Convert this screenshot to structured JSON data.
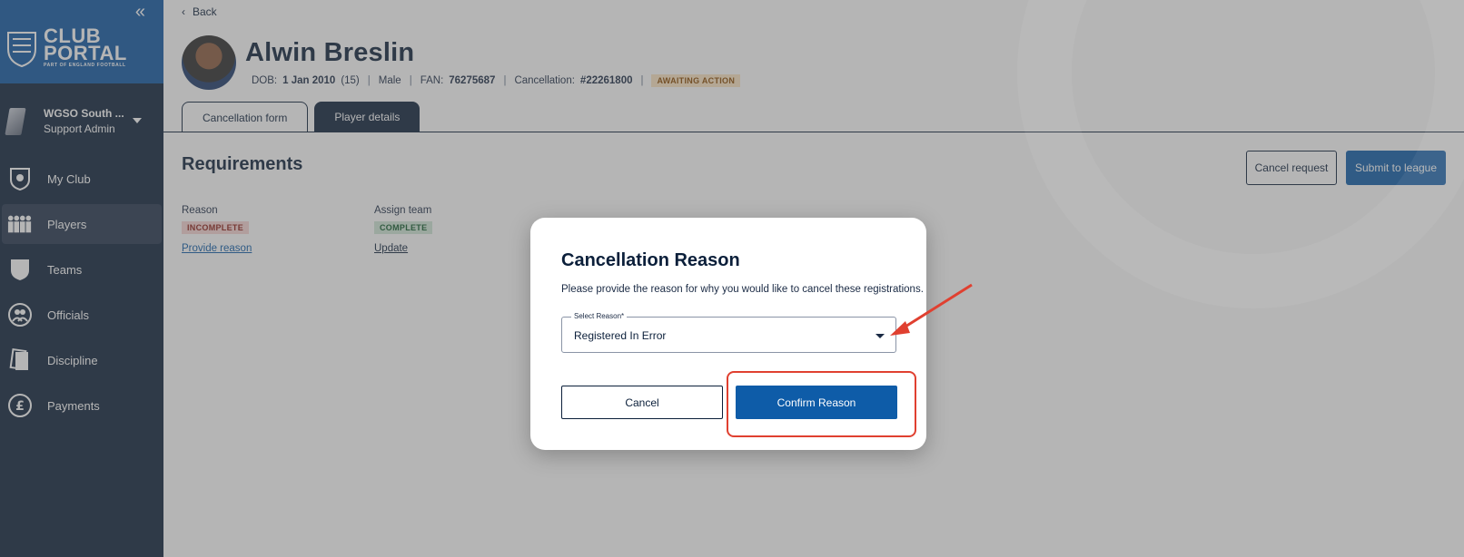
{
  "sidebar": {
    "collapse_icon": "double-chevron-left-icon",
    "logo": {
      "line1": "CLUB",
      "line2": "PORTAL",
      "tagline": "PART OF ENGLAND FOOTBALL"
    },
    "club": {
      "name": "WGSO South ...",
      "role": "Support Admin"
    },
    "nav": [
      {
        "label": "My Club",
        "icon": "club-crest-icon"
      },
      {
        "label": "Players",
        "icon": "players-group-icon",
        "active": true
      },
      {
        "label": "Teams",
        "icon": "shield-icon"
      },
      {
        "label": "Officials",
        "icon": "officials-icon"
      },
      {
        "label": "Discipline",
        "icon": "cards-icon"
      },
      {
        "label": "Payments",
        "icon": "pound-icon"
      }
    ]
  },
  "header": {
    "back_label": "Back",
    "player_name": "Alwin Breslin",
    "dob_label": "DOB:",
    "dob_value": "1 Jan 2010",
    "age": "(15)",
    "gender": "Male",
    "fan_label": "FAN:",
    "fan_value": "76275687",
    "cancellation_label": "Cancellation:",
    "cancellation_value": "#22261800",
    "status": "AWAITING ACTION"
  },
  "tabs": [
    {
      "label": "Cancellation form",
      "active": true
    },
    {
      "label": "Player details",
      "active": false
    }
  ],
  "requirements": {
    "title": "Requirements",
    "cancel_request": "Cancel request",
    "submit_to_league": "Submit to league",
    "items": [
      {
        "heading": "Reason",
        "status": "INCOMPLETE",
        "action": "Provide reason"
      },
      {
        "heading": "Assign team",
        "status": "COMPLETE",
        "action": "Update"
      }
    ]
  },
  "modal": {
    "title": "Cancellation Reason",
    "description": "Please provide the reason for why you would like to cancel these registrations.",
    "select_label": "Select Reason*",
    "select_value": "Registered In Error",
    "cancel_label": "Cancel",
    "confirm_label": "Confirm Reason"
  },
  "colors": {
    "sidebar_bg": "#0b1f3a",
    "brand_blue": "#0e5ca8",
    "annotation_red": "#e04030"
  }
}
